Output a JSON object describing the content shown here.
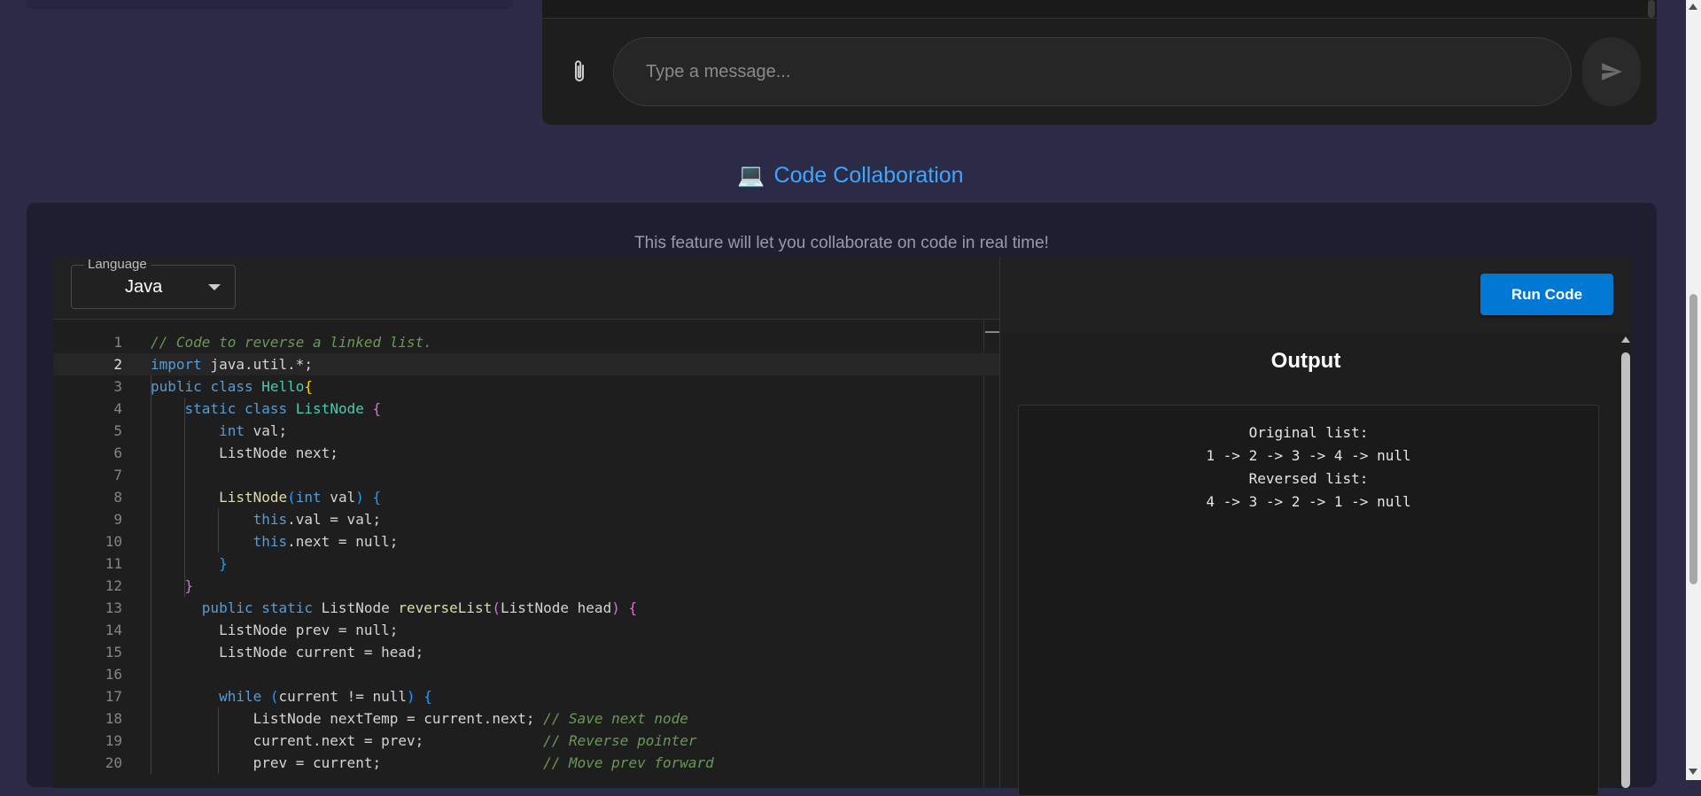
{
  "chat": {
    "input_placeholder": "Type a message...",
    "attach_icon": "paperclip-icon",
    "send_icon": "send-icon"
  },
  "section": {
    "icon": "💻",
    "title": "Code Collaboration",
    "description": "This feature will let you collaborate on code in real time!"
  },
  "editor": {
    "language_legend": "Language",
    "language_value": "Java",
    "active_line": 2,
    "lines": [
      {
        "n": "1",
        "html": "<span class=\"tk-com\">// Code to reverse a linked list.</span>"
      },
      {
        "n": "2",
        "html": "<span class=\"tk-kw\">import</span> java.util.*;"
      },
      {
        "n": "3",
        "html": "<span class=\"tk-kw\">public</span> <span class=\"tk-kw\">class</span> <span class=\"tk-cls\">Hello</span><span class=\"tk-br1\">{</span>"
      },
      {
        "n": "4",
        "html": "    <span class=\"tk-kw\">static</span> <span class=\"tk-kw\">class</span> <span class=\"tk-cls\">ListNode</span> <span class=\"tk-br2\">{</span>"
      },
      {
        "n": "5",
        "html": "        <span class=\"tk-kw\">int</span> val;"
      },
      {
        "n": "6",
        "html": "        ListNode next;"
      },
      {
        "n": "7",
        "html": ""
      },
      {
        "n": "8",
        "html": "        <span class=\"tk-fn\">ListNode</span><span class=\"tk-br3\">(</span><span class=\"tk-kw\">int</span> val<span class=\"tk-br3\">)</span> <span class=\"tk-br3\">{</span>"
      },
      {
        "n": "9",
        "html": "            <span class=\"tk-kw\">this</span>.val = val;"
      },
      {
        "n": "10",
        "html": "            <span class=\"tk-kw\">this</span>.next = null;"
      },
      {
        "n": "11",
        "html": "        <span class=\"tk-br3\">}</span>"
      },
      {
        "n": "12",
        "html": "    <span class=\"tk-br2\">}</span>"
      },
      {
        "n": "13",
        "html": "      <span class=\"tk-kw\">public</span> <span class=\"tk-kw\">static</span> ListNode <span class=\"tk-fn\">reverseList</span><span class=\"tk-br2\">(</span>ListNode head<span class=\"tk-br2\">)</span> <span class=\"tk-br2\">{</span>"
      },
      {
        "n": "14",
        "html": "        ListNode prev = null;"
      },
      {
        "n": "15",
        "html": "        ListNode current = head;"
      },
      {
        "n": "16",
        "html": ""
      },
      {
        "n": "17",
        "html": "        <span class=\"tk-kw\">while</span> <span class=\"tk-br3\">(</span>current != null<span class=\"tk-br3\">)</span> <span class=\"tk-br3\">{</span>"
      },
      {
        "n": "18",
        "html": "            ListNode nextTemp = current.next; <span class=\"tk-com\">// Save next node</span>"
      },
      {
        "n": "19",
        "html": "            current.next = prev;              <span class=\"tk-com\">// Reverse pointer</span>"
      },
      {
        "n": "20",
        "html": "            prev = current;                   <span class=\"tk-com\">// Move prev forward</span>"
      }
    ]
  },
  "run": {
    "label": "Run Code"
  },
  "output": {
    "title": "Output",
    "text": "Original list:\n1 -> 2 -> 3 -> 4 -> null\nReversed list:\n4 -> 3 -> 2 -> 1 -> null"
  },
  "colors": {
    "page_bg": "#2b2b47",
    "accent": "#3ea6ff",
    "run_button": "#0078d4"
  }
}
